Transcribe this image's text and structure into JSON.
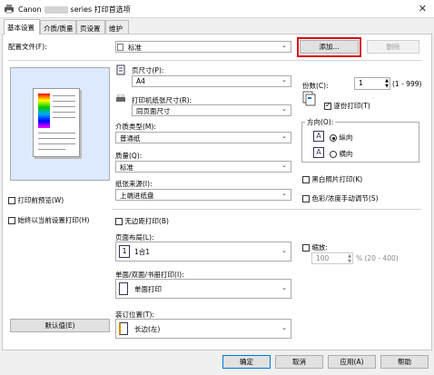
{
  "window": {
    "title_prefix": "Canon",
    "title_suffix": "series 打印首选项",
    "close": "✕"
  },
  "tabs": [
    "基本设置",
    "介质/质量",
    "页设置",
    "维护"
  ],
  "profile": {
    "label": "配置文件(F):",
    "value": "标准",
    "add": "添加...",
    "delete": "删除"
  },
  "page_size": {
    "label": "页尺寸(P):",
    "value": "A4"
  },
  "output_size": {
    "label": "打印机纸张尺寸(R):",
    "value": "同页面尺寸"
  },
  "media": {
    "label": "介质类型(M):",
    "value": "普通纸"
  },
  "quality": {
    "label": "质量(Q):",
    "value": "标准"
  },
  "source": {
    "label": "纸张来源(I):",
    "value": "上端进纸盘"
  },
  "preview_before": "打印前预览(W)",
  "always_current": "始终以当前设置打印(H)",
  "defaults": "默认值(E)",
  "copies": {
    "label": "份数(C):",
    "value": "1",
    "range": "(1 - 999)",
    "collate": "逐份打印(T)"
  },
  "orientation": {
    "label": "方向(O):",
    "portrait": "纵向",
    "landscape": "横向",
    "icon": "A"
  },
  "grayscale": "黑白照片打印(K)",
  "color_manual": "色彩/浓度手动调节(S)",
  "borderless": "无边距打印(B)",
  "layout": {
    "label": "页面布局(L):",
    "value": "1合1",
    "icon": "1"
  },
  "duplex": {
    "label": "单面/双面/书册打印(I):",
    "value": "单面打印"
  },
  "stapling": {
    "label": "装订位置(T):",
    "value": "长边(左)"
  },
  "scaling": {
    "label": "缩放:",
    "value": "100",
    "range": "% (20 - 400)"
  },
  "bottom": {
    "ok": "确定",
    "cancel": "取消",
    "apply": "应用(A)",
    "help": "帮助"
  }
}
